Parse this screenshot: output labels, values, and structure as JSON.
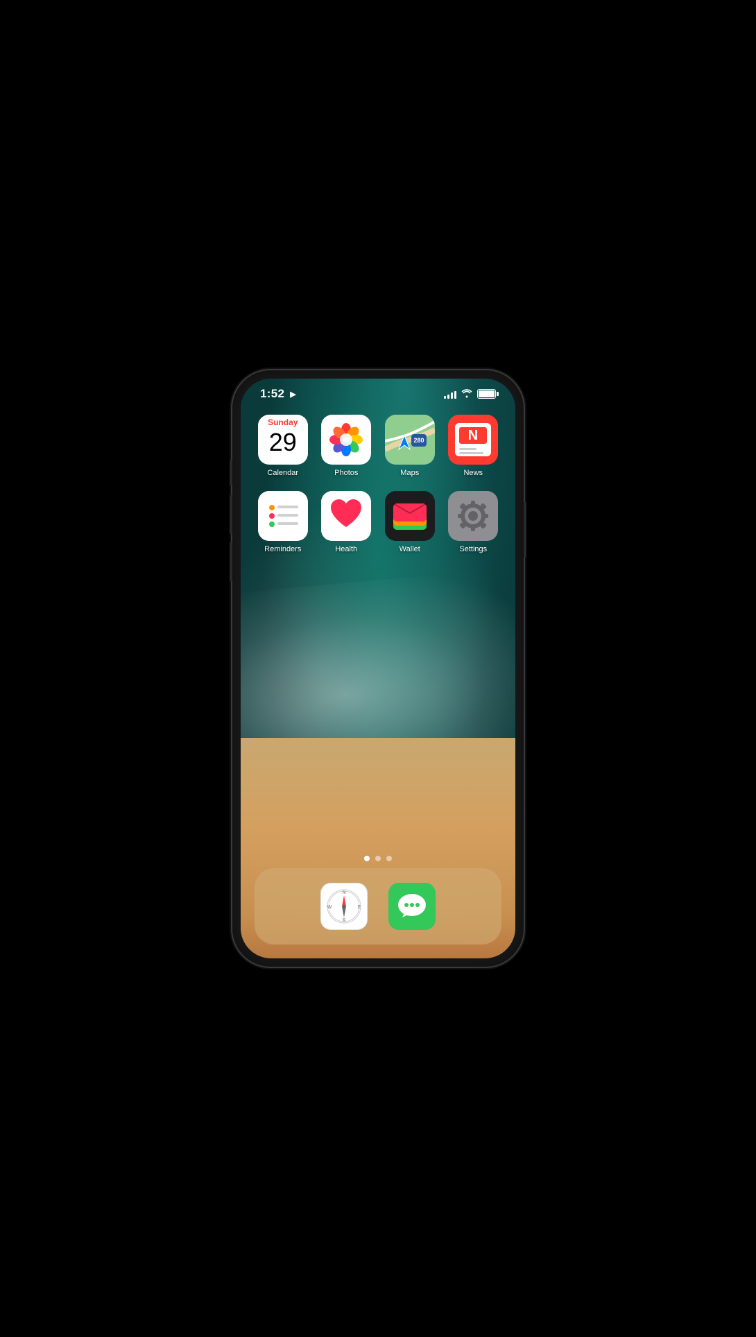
{
  "status": {
    "time": "1:52",
    "location_arrow": "➤",
    "signal_bars": [
      4,
      6,
      8,
      10,
      12
    ],
    "wifi": "wifi",
    "battery_level": 100
  },
  "apps": {
    "row1": [
      {
        "id": "calendar",
        "label": "Calendar",
        "day": "Sunday",
        "date": "29"
      },
      {
        "id": "photos",
        "label": "Photos"
      },
      {
        "id": "maps",
        "label": "Maps"
      },
      {
        "id": "news",
        "label": "News"
      }
    ],
    "row2": [
      {
        "id": "reminders",
        "label": "Reminders"
      },
      {
        "id": "health",
        "label": "Health"
      },
      {
        "id": "wallet",
        "label": "Wallet"
      },
      {
        "id": "settings",
        "label": "Settings"
      }
    ]
  },
  "dock": {
    "apps": [
      {
        "id": "safari",
        "label": "Safari"
      },
      {
        "id": "messages",
        "label": "Messages"
      }
    ]
  },
  "page_dots": {
    "count": 3,
    "active": 0
  }
}
